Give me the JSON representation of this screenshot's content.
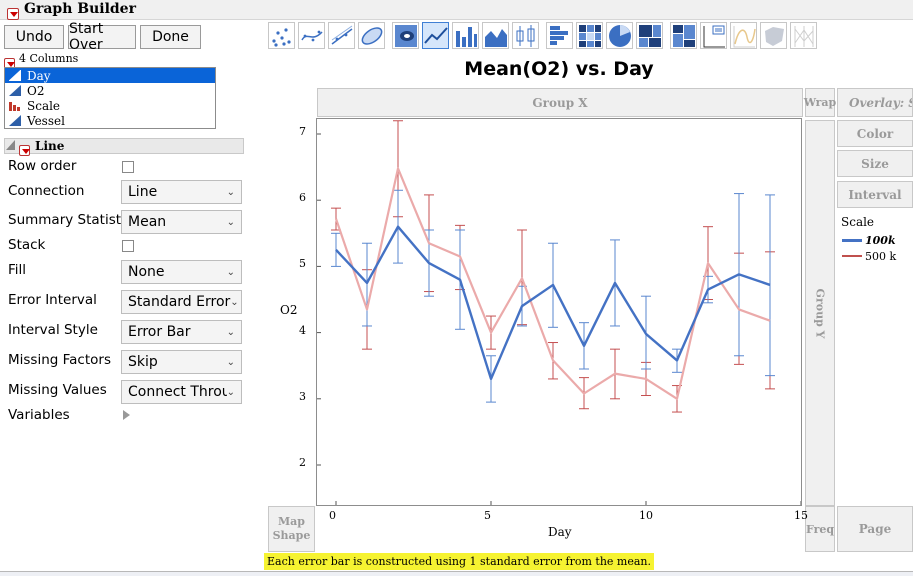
{
  "window": {
    "title": "Graph Builder"
  },
  "buttons": {
    "undo": "Undo",
    "start_over": "Start Over",
    "done": "Done"
  },
  "columns": {
    "header": "4 Columns",
    "items": [
      {
        "label": "Day",
        "type": "continuous",
        "selected": true
      },
      {
        "label": "O2",
        "type": "continuous"
      },
      {
        "label": "Scale",
        "type": "nominal"
      },
      {
        "label": "Vessel",
        "type": "continuous"
      }
    ]
  },
  "element_panel": {
    "title": "Line",
    "row_order": {
      "label": "Row order"
    },
    "connection": {
      "label": "Connection",
      "value": "Line"
    },
    "summary_statistic": {
      "label": "Summary Statistic",
      "value": "Mean"
    },
    "stack": {
      "label": "Stack"
    },
    "fill": {
      "label": "Fill",
      "value": "None"
    },
    "error_interval": {
      "label": "Error Interval",
      "value": "Standard Error"
    },
    "interval_style": {
      "label": "Interval Style",
      "value": "Error Bar"
    },
    "missing_factors": {
      "label": "Missing Factors",
      "value": "Skip"
    },
    "missing_values": {
      "label": "Missing Values",
      "value": "Connect Through"
    },
    "variables": {
      "label": "Variables"
    }
  },
  "toolbar": {
    "icons": [
      "points-icon",
      "smoother-icon",
      "line-of-fit-icon",
      "ellipse-icon",
      "contour-icon",
      "line-icon",
      "bar-icon",
      "area-icon",
      "box-plot-icon",
      "histogram-icon",
      "heatmap-icon",
      "pie-icon",
      "treemap-icon",
      "mosaic-icon",
      "caption-box-icon",
      "formula-icon",
      "map-shape-icon",
      "parallel-icon"
    ],
    "selected": "line-icon"
  },
  "zones": {
    "group_x": "Group X",
    "group_y": "Group Y",
    "wrap": "Wrap",
    "overlay": "Overlay: Scale",
    "color": "Color",
    "size": "Size",
    "interval": "Interval",
    "map_shape": "Map Shape",
    "freq": "Freq",
    "page": "Page"
  },
  "legend": {
    "title": "Scale",
    "items": [
      {
        "label": "100k",
        "color": "#4472c4"
      },
      {
        "label": "500 k",
        "color": "#c0504d"
      }
    ]
  },
  "footnote": "Each error bar is constructed using 1 standard error from the mean.",
  "colors": {
    "series_blue": "#4472c4",
    "series_pink": "#ebaaaa",
    "error_blue": "#5a87cf",
    "error_red": "#c44f50",
    "highlight": "#f6f331"
  },
  "chart_data": {
    "type": "line",
    "title": "Mean(O2) vs. Day",
    "xlabel": "Day",
    "ylabel": "O2",
    "xlim": [
      -0.5,
      15
    ],
    "ylim": [
      1.5,
      7.3
    ],
    "xticks": [
      0,
      5,
      10,
      15
    ],
    "yticks": [
      2,
      3,
      4,
      5,
      6,
      7
    ],
    "series": [
      {
        "name": "100k",
        "x": [
          0,
          1,
          2,
          3,
          4,
          5,
          6,
          7,
          8,
          9,
          10,
          11,
          12,
          13,
          14
        ],
        "y": [
          5.25,
          4.75,
          5.6,
          5.05,
          4.8,
          3.3,
          4.4,
          4.72,
          3.8,
          4.75,
          3.98,
          3.58,
          4.65,
          4.88,
          4.72
        ],
        "lower": [
          5.0,
          4.1,
          5.05,
          4.55,
          4.05,
          2.95,
          4.1,
          4.08,
          3.45,
          4.1,
          3.45,
          3.4,
          4.45,
          3.65,
          3.35
        ],
        "upper": [
          5.5,
          5.35,
          6.15,
          5.55,
          5.55,
          3.65,
          4.7,
          5.35,
          4.15,
          5.4,
          4.55,
          3.75,
          4.85,
          6.1,
          6.08
        ]
      },
      {
        "name": "500 k",
        "x": [
          0,
          1,
          2,
          3,
          4,
          5,
          6,
          7,
          8,
          9,
          10,
          11,
          12,
          13,
          14
        ],
        "y": [
          5.72,
          4.35,
          6.48,
          5.35,
          5.15,
          4.0,
          4.82,
          3.58,
          3.08,
          3.38,
          3.3,
          3.0,
          5.05,
          4.35,
          4.18
        ],
        "lower": [
          5.55,
          3.75,
          5.75,
          4.62,
          4.65,
          3.75,
          4.12,
          3.3,
          2.85,
          3.0,
          3.05,
          2.8,
          4.5,
          3.52,
          3.15
        ],
        "upper": [
          5.88,
          4.95,
          7.2,
          6.08,
          5.62,
          4.25,
          5.55,
          3.85,
          3.32,
          3.75,
          3.55,
          3.2,
          5.6,
          5.2,
          5.22
        ]
      }
    ]
  }
}
